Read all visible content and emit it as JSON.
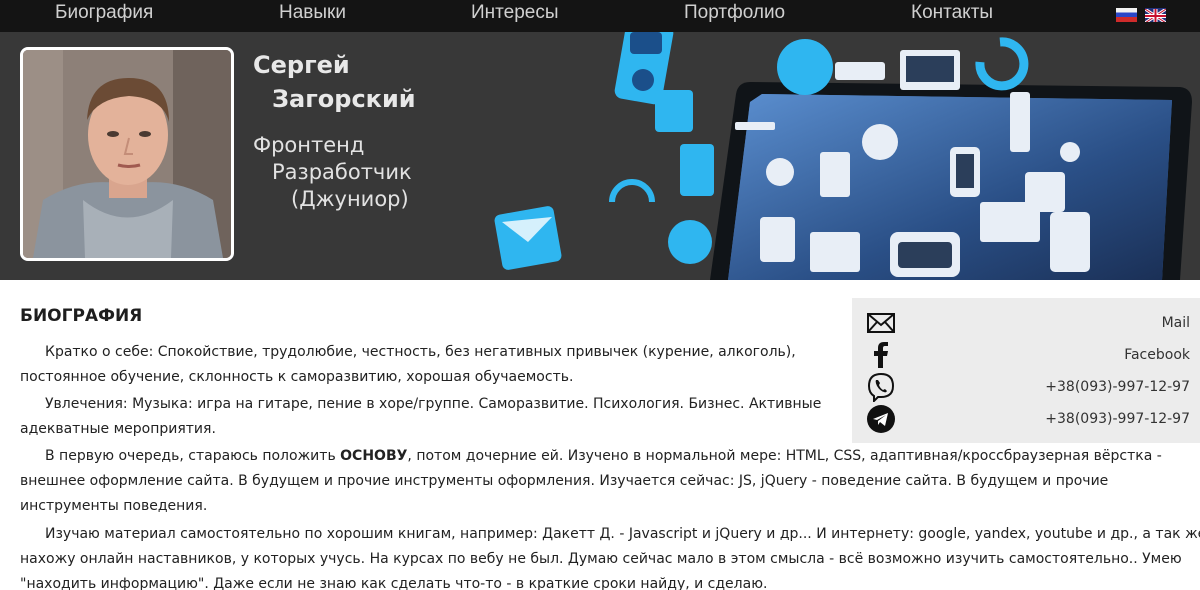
{
  "nav": {
    "items": [
      "Биография",
      "Навыки",
      "Интересы",
      "Портфолио",
      "Контакты"
    ],
    "languages": [
      "ru",
      "en"
    ]
  },
  "hero": {
    "first_name": "Сергей",
    "last_name": "Загорский",
    "role_line1": "Фронтенд",
    "role_line2": "Разработчик",
    "role_line3": "(Джуниор)"
  },
  "bio": {
    "title": "БИОГРАФИЯ",
    "p1": "Кратко о себе: Спокойствие, трудолюбие, честность, без негативных привычек (курение, алкоголь), постоянное обучение, склонность к саморазвитию, хорошая обучаемость.",
    "p2": "Увлечения: Музыка: игра на гитаре, пение в хоре/группе. Саморазвитие. Психология. Бизнес. Активные адекватные мероприятия.",
    "p3_before": "В первую очередь, стараюсь положить ",
    "p3_bold": "ОСНОВУ",
    "p3_after": ", потом дочерние ей. Изучено в нормальной мере: HTML, CSS, адаптивная/кроссбраузерная вёрстка - внешнее оформление сайта. В будущем и прочие инструменты оформления. Изучается сейчас: JS, jQuery - поведение сайта. В будущем и прочие инструменты поведения.",
    "p4": "Изучаю материал самостоятельно по хорошим книгам, например: Дакетт Д. - Javascript и jQuery и др... И интернету: google, yandex, youtube и др., а так же, нахожу онлайн наставников, у которых учусь. На курсах по вебу не был. Думаю сейчас мало в этом смысла - всё возможно изучить самостоятельно.. Умею \"находить информацию\". Даже если не знаю как сделать что-то - в краткие сроки найду, и сделаю."
  },
  "contacts": {
    "mail": "Mail",
    "facebook": "Facebook",
    "viber": "+38(093)-997-12-97",
    "telegram": "+38(093)-997-12-97"
  },
  "colors": {
    "nav_bg": "#141414",
    "hero_bg": "#383838",
    "accent_icon": "#2fb6f0",
    "panel_bg": "#ececec"
  }
}
